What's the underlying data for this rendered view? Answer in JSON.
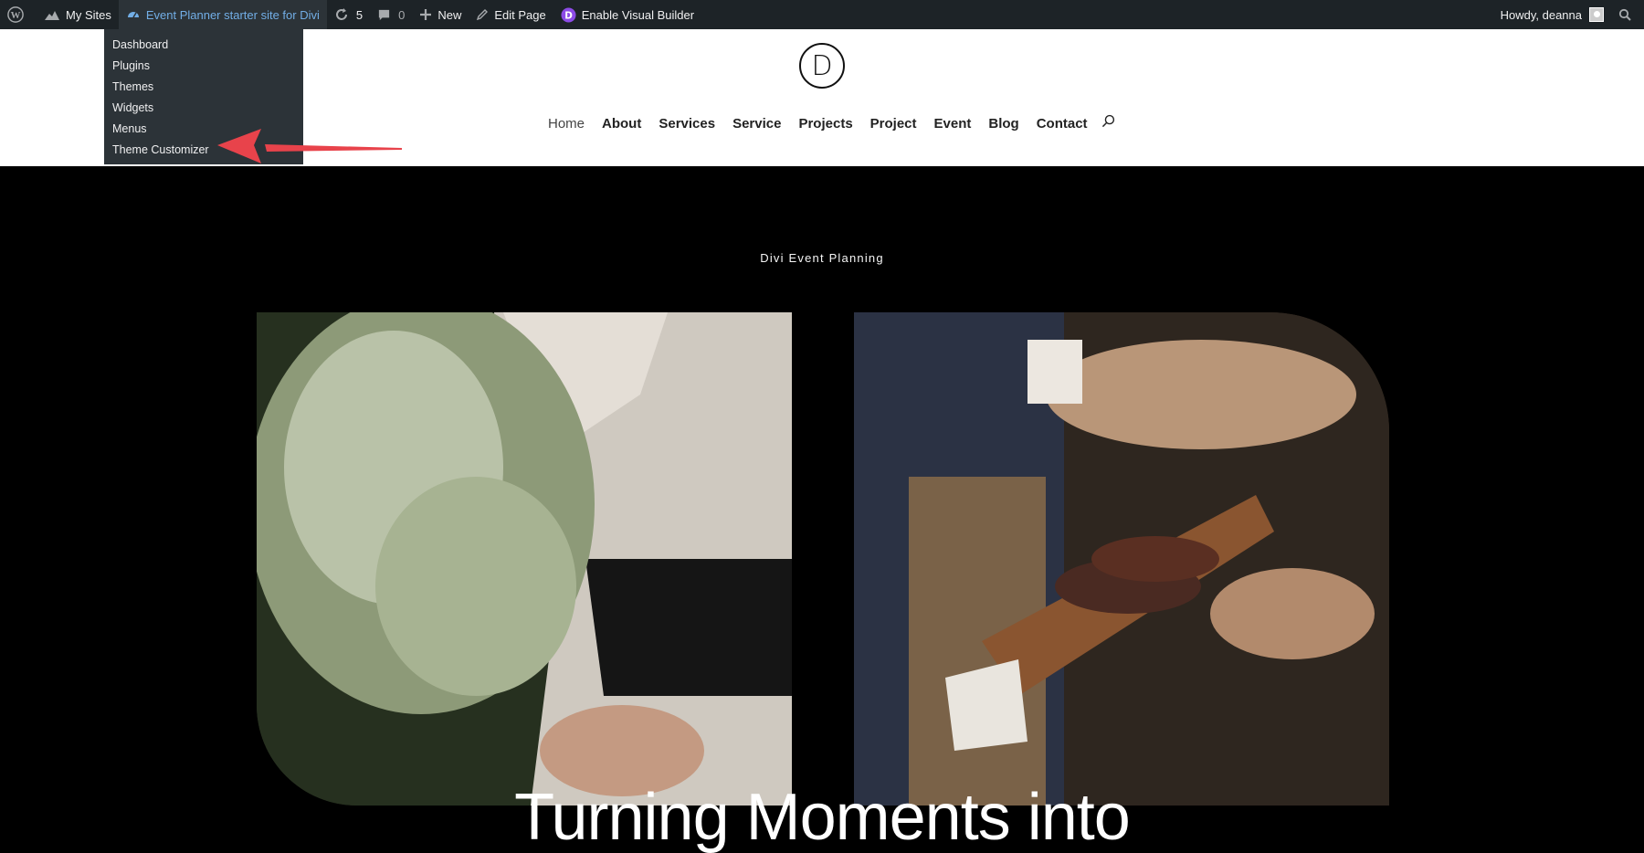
{
  "adminbar": {
    "my_sites": "My Sites",
    "site_name": "Event Planner starter site for Divi",
    "updates_count": "5",
    "comments_count": "0",
    "new_label": "New",
    "edit_page": "Edit Page",
    "visual_builder": "Enable Visual Builder",
    "howdy": "Howdy, deanna"
  },
  "dropdown": {
    "items": [
      "Dashboard",
      "Plugins",
      "Themes",
      "Widgets",
      "Menus",
      "Theme Customizer"
    ]
  },
  "header": {
    "logo_letter": "D",
    "nav": [
      "Home",
      "About",
      "Services",
      "Service",
      "Projects",
      "Project",
      "Event",
      "Blog",
      "Contact"
    ]
  },
  "hero": {
    "kicker": "Divi Event Planning",
    "headline": "Turning Moments into"
  },
  "colors": {
    "adminbar_bg": "#1d2327",
    "dropdown_bg": "#2c3338",
    "link_blue": "#72aee6",
    "arrow_red": "#e8434b",
    "divi_purple": "#8c4be6"
  }
}
